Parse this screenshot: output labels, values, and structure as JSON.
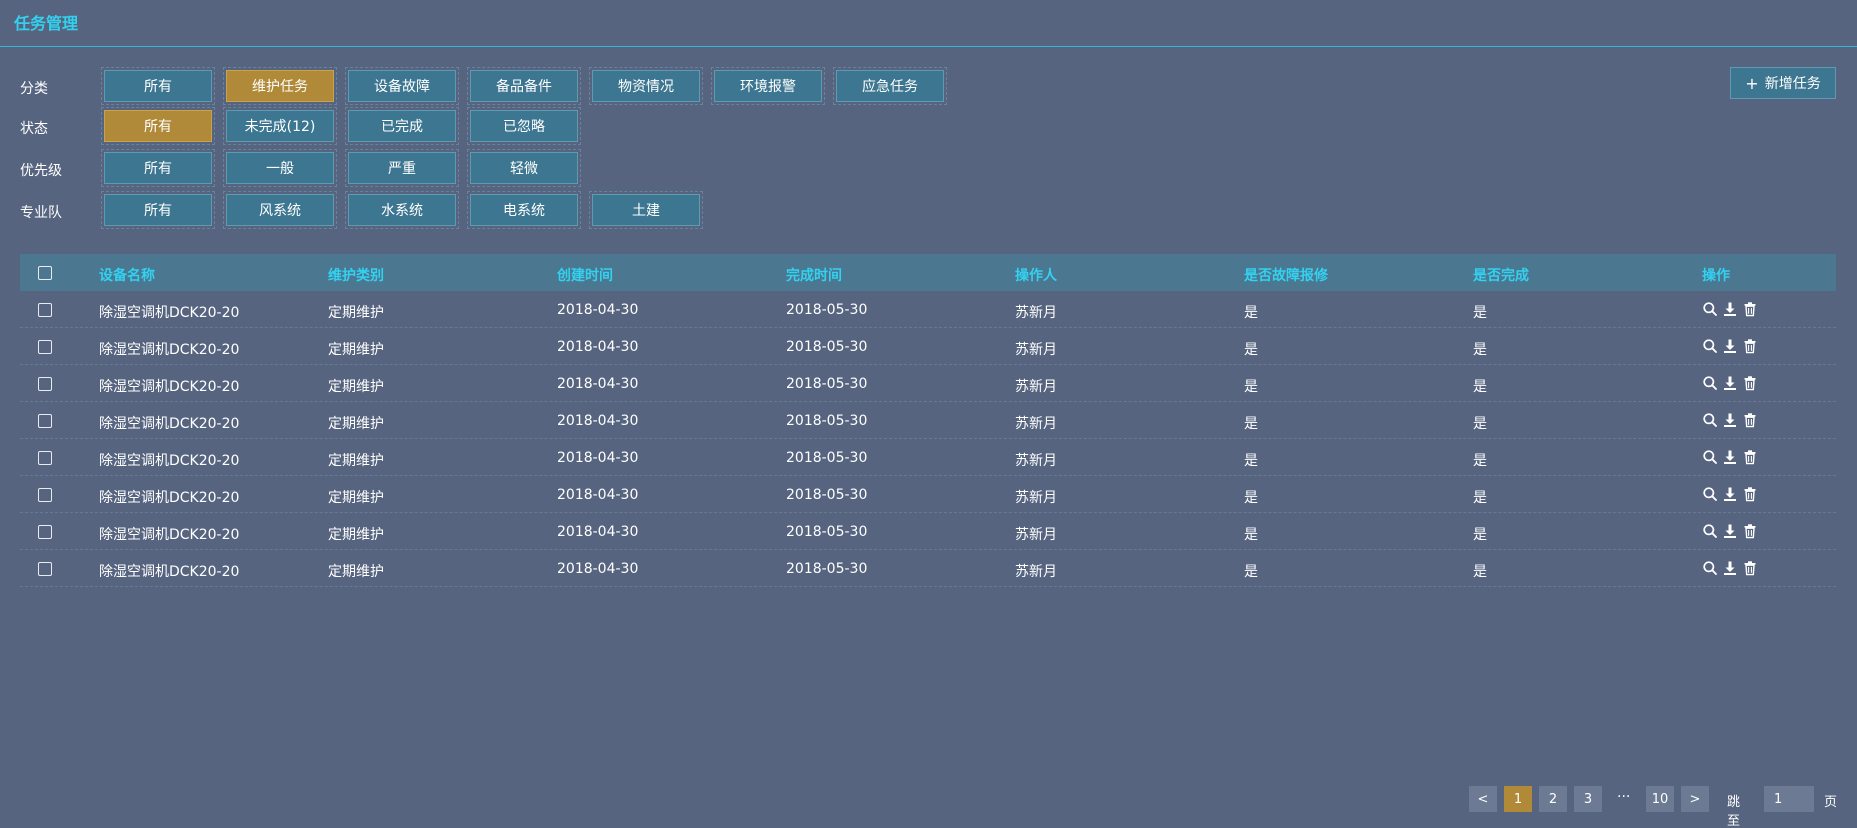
{
  "header": {
    "title": "任务管理"
  },
  "filters": {
    "category": {
      "label": "分类",
      "options": [
        "所有",
        "维护任务",
        "设备故障",
        "备品备件",
        "物资情况",
        "环境报警",
        "应急任务"
      ]
    },
    "status": {
      "label": "状态",
      "options": [
        "所有",
        "未完成(12)",
        "已完成",
        "已忽略"
      ]
    },
    "priority": {
      "label": "优先级",
      "options": [
        "所有",
        "一般",
        "严重",
        "轻微"
      ]
    },
    "team": {
      "label": "专业队",
      "options": [
        "所有",
        "风系统",
        "水系统",
        "电系统",
        "土建"
      ]
    }
  },
  "new_task_button": {
    "plus": "+",
    "label": "新增任务"
  },
  "table": {
    "columns": [
      "设备名称",
      "维护类别",
      "创建时间",
      "完成时间",
      "操作人",
      "是否故障报修",
      "是否完成",
      "操作"
    ],
    "rows": [
      [
        "除湿空调机DCK20-20",
        "定期维护",
        "2018-04-30",
        "2018-05-30",
        "苏新月",
        "是",
        "是"
      ],
      [
        "除湿空调机DCK20-20",
        "定期维护",
        "2018-04-30",
        "2018-05-30",
        "苏新月",
        "是",
        "是"
      ],
      [
        "除湿空调机DCK20-20",
        "定期维护",
        "2018-04-30",
        "2018-05-30",
        "苏新月",
        "是",
        "是"
      ],
      [
        "除湿空调机DCK20-20",
        "定期维护",
        "2018-04-30",
        "2018-05-30",
        "苏新月",
        "是",
        "是"
      ],
      [
        "除湿空调机DCK20-20",
        "定期维护",
        "2018-04-30",
        "2018-05-30",
        "苏新月",
        "是",
        "是"
      ],
      [
        "除湿空调机DCK20-20",
        "定期维护",
        "2018-04-30",
        "2018-05-30",
        "苏新月",
        "是",
        "是"
      ],
      [
        "除湿空调机DCK20-20",
        "定期维护",
        "2018-04-30",
        "2018-05-30",
        "苏新月",
        "是",
        "是"
      ],
      [
        "除湿空调机DCK20-20",
        "定期维护",
        "2018-04-30",
        "2018-05-30",
        "苏新月",
        "是",
        "是"
      ]
    ],
    "row_actions": [
      "search-icon",
      "download-icon",
      "trash-icon"
    ]
  },
  "pagination": {
    "prev": "<",
    "pages": [
      "1",
      "2",
      "3"
    ],
    "ellipsis": "···",
    "last": "10",
    "next": ">",
    "goto_label": "跳至",
    "goto_value": "1",
    "page_suffix": "页"
  },
  "colors": {
    "background": "#56647f",
    "accent_text": "#33d1f0",
    "chip": "#3c7690",
    "chip_active": "#b08a38"
  }
}
